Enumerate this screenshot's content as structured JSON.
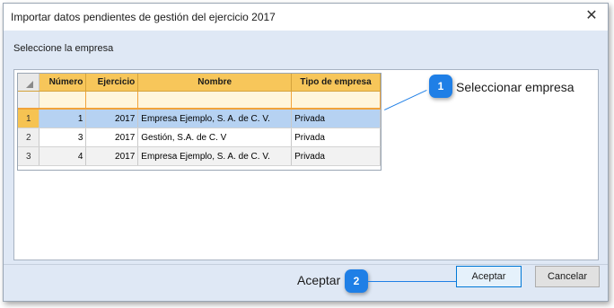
{
  "window": {
    "title": "Importar datos pendientes de gestión del ejercicio 2017"
  },
  "instruction": "Seleccione la empresa",
  "grid": {
    "columns": [
      "Número",
      "Ejercicio",
      "Nombre",
      "Tipo de empresa"
    ],
    "rows": [
      {
        "row_num": "1",
        "numero": "1",
        "ejercicio": "2017",
        "nombre": "Empresa Ejemplo, S. A. de C. V.",
        "tipo": "Privada"
      },
      {
        "row_num": "2",
        "numero": "3",
        "ejercicio": "2017",
        "nombre": "Gestión, S.A. de C. V",
        "tipo": "Privada"
      },
      {
        "row_num": "3",
        "numero": "4",
        "ejercicio": "2017",
        "nombre": "Empresa Ejemplo, S. A. de C. V.",
        "tipo": "Privada"
      }
    ],
    "selected_row": 1
  },
  "callouts": [
    {
      "number": "1",
      "label": "Seleccionar empresa"
    },
    {
      "number": "2",
      "label": "Aceptar"
    }
  ],
  "buttons": {
    "accept": "Aceptar",
    "cancel": "Cancelar"
  },
  "colors": {
    "accent": "#1f7fe6",
    "header": "#f7c65a",
    "selection": "#b6d2f2",
    "dialog_bg": "#dfe8f5"
  },
  "icons": {
    "close": "close-icon"
  }
}
